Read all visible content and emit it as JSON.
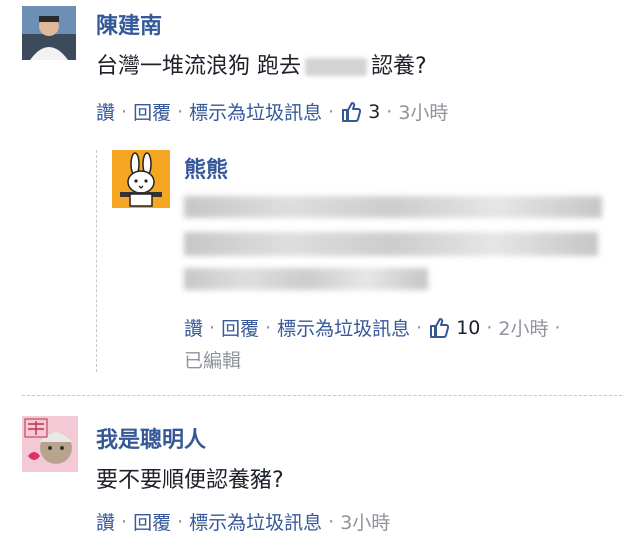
{
  "comments": [
    {
      "name": "陳建南",
      "text_before": "台灣一堆流浪狗 跑去",
      "text_after": "認養?",
      "actions": {
        "like": "讚",
        "reply": "回覆",
        "spam": "標示為垃圾訊息",
        "likes": "3",
        "time": "3小時"
      }
    },
    {
      "name": "熊熊",
      "actions": {
        "like": "讚",
        "reply": "回覆",
        "spam": "標示為垃圾訊息",
        "likes": "10",
        "time": "2小時",
        "edited": "已編輯"
      }
    },
    {
      "name": "我是聰明人",
      "text": "要不要順便認養豬?",
      "actions": {
        "like": "讚",
        "reply": "回覆",
        "spam": "標示為垃圾訊息",
        "time": "3小時"
      }
    }
  ],
  "separator": "·",
  "colors": {
    "link": "#365899",
    "muted": "#90949c",
    "text": "#1d2129",
    "avatar_orange": "#f5a623"
  }
}
